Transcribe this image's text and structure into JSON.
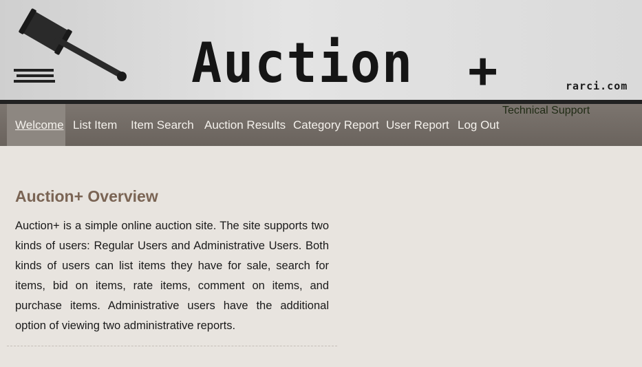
{
  "header": {
    "logo_text": "Auction",
    "logo_plus": "+",
    "site_credit": "rarci.com"
  },
  "nav": {
    "items": [
      {
        "label": "Welcome",
        "active": true
      },
      {
        "label": "List Item"
      },
      {
        "label": "Item Search"
      },
      {
        "label": "Auction Results"
      },
      {
        "label": "Category Report"
      },
      {
        "label": "User Report"
      },
      {
        "label": "Log Out"
      }
    ],
    "support_link": "Technical Support"
  },
  "main": {
    "title": "Auction+ Overview",
    "body": "Auction+ is a simple online auction site. The site supports two kinds of users: Regular Users and Administrative Users. Both kinds of users can list items they have for sale, search for items, bid on items, rate items, comment on items, and purchase items. Administrative users have the additional option of viewing two administrative reports."
  }
}
